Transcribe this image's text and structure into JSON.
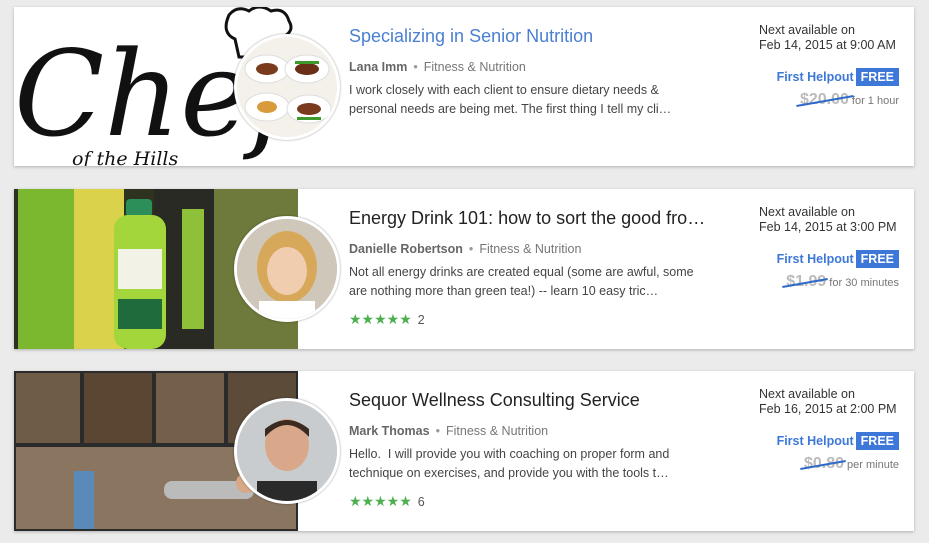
{
  "listings": [
    {
      "title": "Specializing in Senior Nutrition",
      "provider": "Lana Imm",
      "category": "Fitness & Nutrition",
      "description": "I work closely with each client to ensure dietary needs & personal needs are being met. The first thing I tell my cli…",
      "thumb_text_main": "Chef",
      "thumb_text_sub": "of the Hills",
      "next_label": "Next available on",
      "next_date": "Feb 14, 2015 at 9:00 AM",
      "first_helpout": "First Helpout",
      "free": "FREE",
      "old_price": "$20.00",
      "unit": "for 1 hour"
    },
    {
      "title": "Energy Drink 101: how to sort the good from…",
      "provider": "Danielle Robertson",
      "category": "Fitness & Nutrition",
      "description": "Not all energy drinks are created equal (some are awful, some are nothing more than green tea!) -- learn 10 easy tric…",
      "stars": "★★★★★",
      "rating_count": "2",
      "next_label": "Next available on",
      "next_date": "Feb 14, 2015 at 3:00 PM",
      "first_helpout": "First Helpout",
      "free": "FREE",
      "old_price": "$1.99",
      "unit": "for 30 minutes"
    },
    {
      "title": "Sequor Wellness Consulting Service",
      "provider": "Mark Thomas",
      "category": "Fitness & Nutrition",
      "description": "Hello.  I will provide you with coaching on proper form and technique on exercises, and provide you with the tools t…",
      "stars": "★★★★★",
      "rating_count": "6",
      "next_label": "Next available on",
      "next_date": "Feb 16, 2015 at 2:00 PM",
      "first_helpout": "First Helpout",
      "free": "FREE",
      "old_price": "$0.80",
      "unit": "per minute"
    }
  ]
}
